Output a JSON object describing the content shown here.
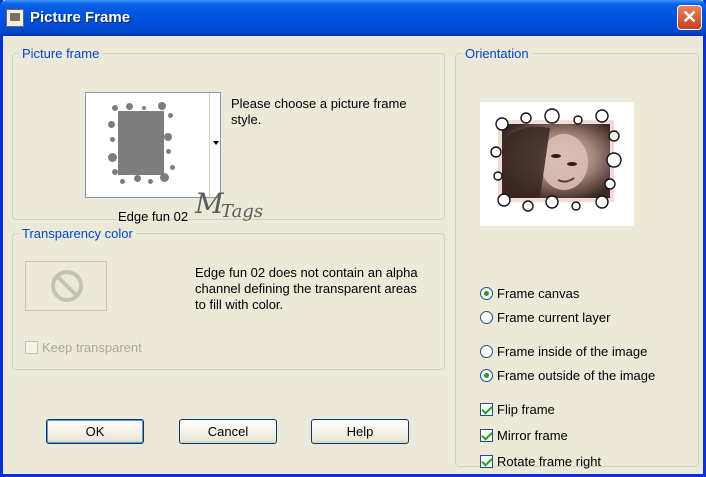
{
  "window": {
    "title": "Picture Frame",
    "close_label": "✕",
    "icon": "picture-frame-app-icon"
  },
  "picture_frame": {
    "legend": "Picture frame",
    "selected_style": "Edge fun 02",
    "instruction": "Please choose a picture frame style.",
    "watermark_big": "M",
    "watermark_small": "Tags"
  },
  "transparency": {
    "legend": "Transparency color",
    "message": "Edge fun 02 does not contain an alpha channel defining the transparent areas to fill with color.",
    "keep_transparent_label": "Keep transparent",
    "keep_transparent_checked": false,
    "keep_transparent_enabled": false,
    "swatch_icon": "no-symbol-icon"
  },
  "orientation": {
    "legend": "Orientation",
    "options": [
      {
        "label": "Frame canvas",
        "checked": true
      },
      {
        "label": "Frame current layer",
        "checked": false
      },
      {
        "label": "Frame inside of the image",
        "checked": false
      },
      {
        "label": "Frame outside of the image",
        "checked": true
      }
    ],
    "checkboxes": [
      {
        "label": "Flip frame",
        "checked": true
      },
      {
        "label": "Mirror frame",
        "checked": true
      },
      {
        "label": "Rotate frame right",
        "checked": true
      }
    ]
  },
  "buttons": {
    "ok": "OK",
    "cancel": "Cancel",
    "help": "Help"
  },
  "colors": {
    "accent": "#0046d5",
    "title_bar": "#0054e3",
    "close": "#c5401e",
    "check": "#21a121"
  }
}
